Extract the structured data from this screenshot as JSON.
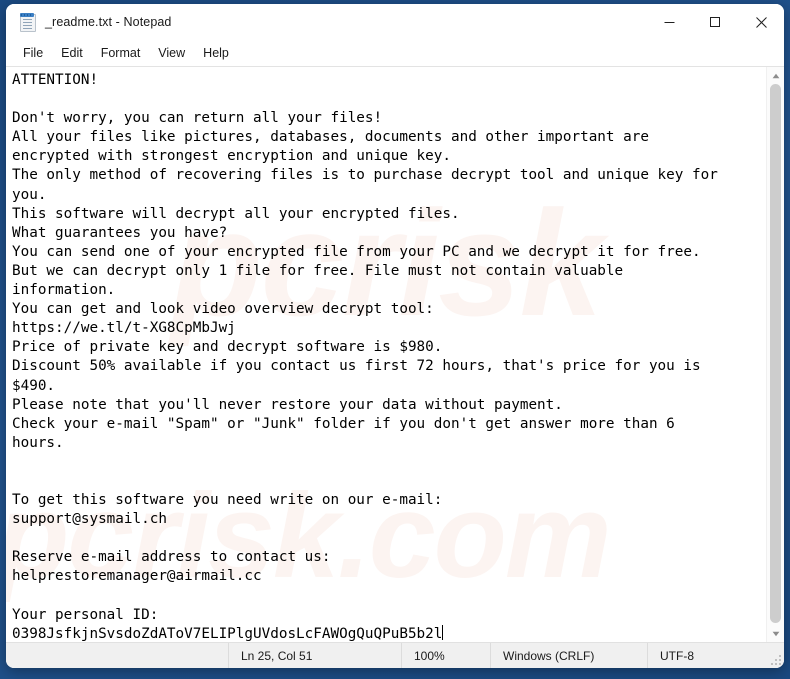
{
  "window": {
    "title": "_readme.txt - Notepad",
    "icon": "notepad-icon",
    "controls": {
      "minimize": "Minimize",
      "maximize": "Maximize",
      "close": "Close"
    }
  },
  "menubar": {
    "items": [
      {
        "label": "File"
      },
      {
        "label": "Edit"
      },
      {
        "label": "Format"
      },
      {
        "label": "View"
      },
      {
        "label": "Help"
      }
    ]
  },
  "document": {
    "filename": "_readme.txt",
    "lines": [
      "ATTENTION!",
      "",
      "Don't worry, you can return all your files!",
      "All your files like pictures, databases, documents and other important are",
      "encrypted with strongest encryption and unique key.",
      "The only method of recovering files is to purchase decrypt tool and unique key for",
      "you.",
      "This software will decrypt all your encrypted files.",
      "What guarantees you have?",
      "You can send one of your encrypted file from your PC and we decrypt it for free.",
      "But we can decrypt only 1 file for free. File must not contain valuable",
      "information.",
      "You can get and look video overview decrypt tool:",
      "https://we.tl/t-XG8CpMbJwj",
      "Price of private key and decrypt software is $980.",
      "Discount 50% available if you contact us first 72 hours, that's price for you is",
      "$490.",
      "Please note that you'll never restore your data without payment.",
      "Check your e-mail \"Spam\" or \"Junk\" folder if you don't get answer more than 6",
      "hours.",
      "",
      "",
      "To get this software you need write on our e-mail:",
      "support@sysmail.ch",
      "",
      "Reserve e-mail address to contact us:",
      "helprestoremanager@airmail.cc",
      "",
      "Your personal ID:",
      "0398JsfkjnSvsdoZdAToV7ELIPlgUVdosLcFAWOgQuQPuB5b2l"
    ],
    "video_url": "https://we.tl/t-XG8CpMbJwj",
    "price_full": "$980",
    "price_discount": "$490",
    "discount_percent": "50%",
    "discount_window": "72 hours",
    "email_primary": "support@sysmail.ch",
    "email_reserve": "helprestoremanager@airmail.cc",
    "personal_id": "0398JsfkjnSvsdoZdAToV7ELIPlgUVdosLcFAWOgQuQPuB5b2l"
  },
  "statusbar": {
    "cursor": "Ln 25, Col 51",
    "zoom": "100%",
    "line_ending": "Windows (CRLF)",
    "encoding": "UTF-8"
  },
  "scrollbar": {
    "up": "scroll-up",
    "down": "scroll-down"
  },
  "colors": {
    "desktop": "#1f4e86",
    "window": "#ffffff",
    "statusbar": "#f0f0f0",
    "text": "#000000",
    "close_hover": "#e81123"
  }
}
